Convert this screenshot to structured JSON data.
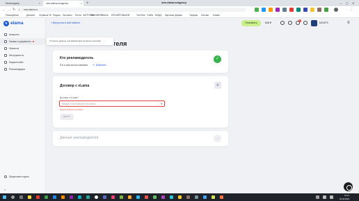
{
  "browser": {
    "tabs": [
      {
        "label": "Мессенджер",
        "active": false
      },
      {
        "label": "new.elama.ru/agency",
        "active": true
      }
    ],
    "new_tab_glyph": "+",
    "page_title": "new.elama.ru/agency",
    "url": "new.elama.ru",
    "window_controls": [
      "—",
      "▢",
      "✕"
    ],
    "bookmarks": [
      "Расширения",
      "Диалоги",
      "Сервисы VK",
      "Яндекс",
      "Контакты",
      "Почта",
      "ЗАГРУЗКИ",
      "МВКЛИЕНТ",
      "Работа",
      "БРОНИРОВАНИЕ",
      "YouTube",
      "Учеба",
      "МОДИ",
      "Карточки фирмы",
      "Тарифы",
      "Контакт",
      "Новые"
    ]
  },
  "sidebar": {
    "logo_text": "elama",
    "items": [
      {
        "label": "Аккаунты",
        "active": false,
        "has_dot": false
      },
      {
        "label": "Заявки и документы",
        "active": true,
        "has_dot": true
      },
      {
        "label": "Финансы",
        "active": false,
        "has_dot": false
      },
      {
        "label": "Инструменты",
        "active": false,
        "has_dot": false
      },
      {
        "label": "Маркетплейс",
        "active": false,
        "has_dot": false
      },
      {
        "label": "Рекомендации",
        "active": false,
        "has_dot": false
      }
    ],
    "bottom_item": "Предложить идею",
    "collapse_icon": "»"
  },
  "topbar": {
    "back_label": "« Вернуться в мой кабинет",
    "balance_button": "Пополнить",
    "amount": "828 ₽",
    "notifications_count": "2",
    "account_name": "MV3279"
  },
  "tooltip": {
    "text": "Уточните данные для маркировки интернет-рекламы"
  },
  "page": {
    "title": "Данные рекламодателя"
  },
  "card_advertiser": {
    "title": "Кто рекламодатель",
    "check_glyph": "✓",
    "line": "Я и я сам лично компания",
    "edit_label": "Изменить"
  },
  "card_contract": {
    "title": "Договор с eLama",
    "brand_glyph": "≡",
    "field_label": "Договор с eLama",
    "field_required_mark": "*",
    "select_placeholder": "Введите или выберите из списка",
    "select_arrow": "▾",
    "error_text": "Нужно выбрать договор",
    "next_button": "Далее"
  },
  "card_data": {
    "title": "Данные рекламодателя",
    "circle_glyph": "…"
  },
  "taskbar": {
    "time": "10:27",
    "date": "20.02.2024"
  },
  "colors": {
    "accent": "#1f5bd6",
    "success": "#35b34a",
    "error": "#e0443a",
    "balance_button": "#c9f08a"
  }
}
